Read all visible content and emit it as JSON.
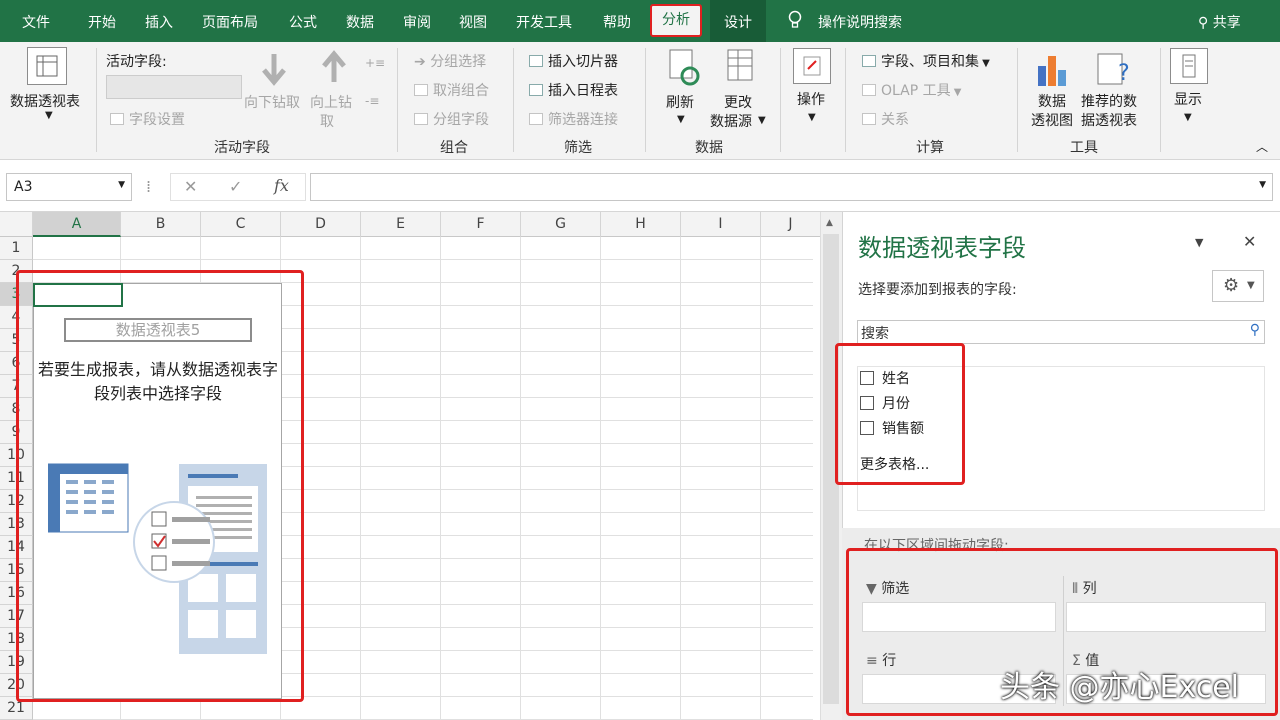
{
  "tabs": {
    "file": "文件",
    "home": "开始",
    "insert": "插入",
    "page_layout": "页面布局",
    "formulas": "公式",
    "data": "数据",
    "review": "审阅",
    "view": "视图",
    "developer": "开发工具",
    "help": "帮助",
    "analyze": "分析",
    "design": "设计",
    "tell_me": "操作说明搜索",
    "share": "共享"
  },
  "ribbon": {
    "pivottable": "数据透视表",
    "active_field_label": "活动字段:",
    "field_settings": "字段设置",
    "drill_down": "向下钻取",
    "drill_up_1": "向上钻",
    "drill_up_2": "取",
    "group_active_field": "活动字段",
    "group_selection": "分组选择",
    "ungroup": "取消组合",
    "group_field": "分组字段",
    "group_group": "组合",
    "insert_slicer": "插入切片器",
    "insert_timeline": "插入日程表",
    "filter_connections": "筛选器连接",
    "group_filter": "筛选",
    "refresh": "刷新",
    "change_source_1": "更改",
    "change_source_2": "数据源",
    "group_data": "数据",
    "actions": "操作",
    "fields_items_sets": "字段、项目和集",
    "olap_tools": "OLAP 工具",
    "relationships": "关系",
    "group_calc": "计算",
    "pivotchart_1": "数据",
    "pivotchart_2": "透视图",
    "recommended_1": "推荐的数",
    "recommended_2": "据透视表",
    "group_tools": "工具",
    "show": "显示"
  },
  "formula_bar": {
    "name_box": "A3",
    "fx": "fx",
    "value": ""
  },
  "sheet": {
    "columns": [
      "A",
      "B",
      "C",
      "D",
      "E",
      "F",
      "G",
      "H",
      "I",
      "J"
    ],
    "rows": [
      "1",
      "2",
      "3",
      "4",
      "5",
      "6",
      "7",
      "8",
      "9",
      "10",
      "11",
      "12",
      "13",
      "14",
      "15",
      "16",
      "17",
      "18",
      "19",
      "20",
      "21"
    ]
  },
  "pivot_placeholder": {
    "name": "数据透视表5",
    "message": "若要生成报表，请从数据透视表字段列表中选择字段"
  },
  "pane": {
    "title": "数据透视表字段",
    "subtitle": "选择要添加到报表的字段:",
    "search_placeholder": "搜索",
    "fields": [
      "姓名",
      "月份",
      "销售额"
    ],
    "more_tables": "更多表格...",
    "drag_hint": "在以下区域间拖动字段:",
    "filters": "筛选",
    "columns": "列",
    "rows": "行",
    "values": "值"
  },
  "watermark": "头条 @亦心Excel",
  "colors": {
    "excel_green": "#217346",
    "highlight_red": "#e02020"
  }
}
